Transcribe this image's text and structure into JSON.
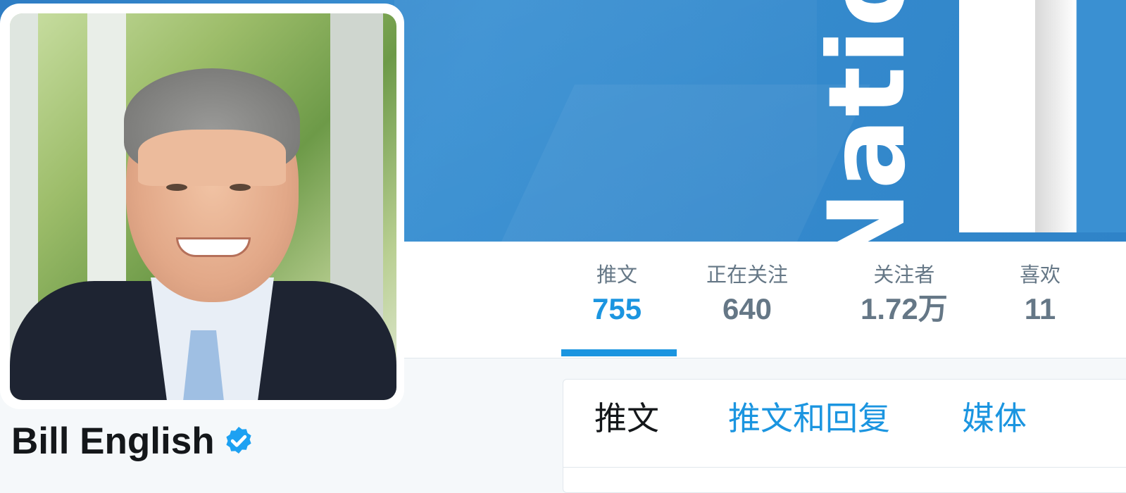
{
  "profile": {
    "name": "Bill English",
    "verified": true
  },
  "banner": {
    "logo_text": "Natio"
  },
  "stats": [
    {
      "label": "推文",
      "value": "755",
      "active": true
    },
    {
      "label": "正在关注",
      "value": "640",
      "active": false
    },
    {
      "label": "关注者",
      "value": "1.72万",
      "active": false
    },
    {
      "label": "喜欢",
      "value": "11",
      "active": false
    }
  ],
  "tabs": [
    {
      "label": "推文",
      "active": true
    },
    {
      "label": "推文和回复",
      "active": false
    },
    {
      "label": "媒体",
      "active": false
    }
  ],
  "colors": {
    "accent": "#1b95e0",
    "banner": "#3a90d2",
    "text": "#14171a",
    "muted": "#657786"
  },
  "icons": {
    "verified": "verified-badge-icon"
  }
}
